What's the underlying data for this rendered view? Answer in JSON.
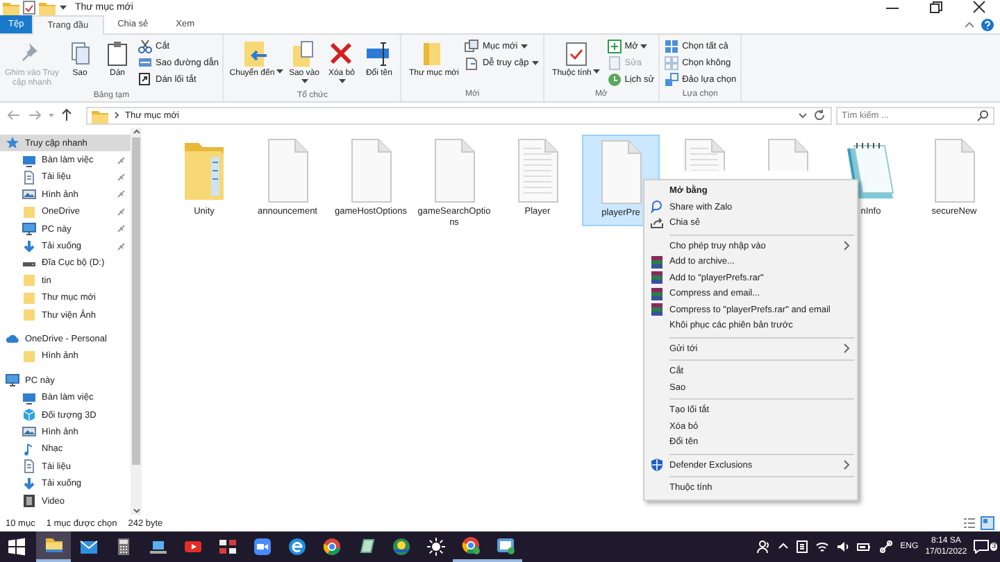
{
  "window": {
    "title": "Thư mục mới"
  },
  "ribbon_tabs": [
    {
      "label": "Tệp",
      "kind": "file",
      "selected": false
    },
    {
      "label": "Trang đầu",
      "kind": "tab",
      "selected": true
    },
    {
      "label": "Chia sẻ",
      "kind": "tab",
      "selected": false
    },
    {
      "label": "Xem",
      "kind": "tab",
      "selected": false
    }
  ],
  "ribbon": {
    "groups": [
      {
        "label": "Bảng tạm",
        "buttons": [
          {
            "label": "Ghim vào Truy cập nhanh",
            "kind": "large",
            "disabled": true,
            "dropdown": false
          },
          {
            "label": "Sao",
            "kind": "large",
            "disabled": false,
            "dropdown": false
          },
          {
            "label": "Dán",
            "kind": "large",
            "disabled": false,
            "dropdown": false
          },
          {
            "label": "Cắt",
            "kind": "small",
            "disabled": false,
            "dropdown": false
          },
          {
            "label": "Sao đường dẫn",
            "kind": "small",
            "disabled": false,
            "dropdown": false
          },
          {
            "label": "Dán lối tắt",
            "kind": "small",
            "disabled": false,
            "dropdown": false
          }
        ]
      },
      {
        "label": "Tổ chức",
        "buttons": [
          {
            "label": "Chuyển đến",
            "kind": "large",
            "disabled": false,
            "dropdown": true
          },
          {
            "label": "Sao vào",
            "kind": "large",
            "disabled": false,
            "dropdown": true
          },
          {
            "label": "Xóa bỏ",
            "kind": "large",
            "disabled": false,
            "dropdown": true
          },
          {
            "label": "Đổi tên",
            "kind": "large",
            "disabled": false,
            "dropdown": false
          }
        ]
      },
      {
        "label": "Mới",
        "buttons": [
          {
            "label": "Thư mục mới",
            "kind": "large",
            "disabled": false,
            "dropdown": false
          },
          {
            "label": "Mục mới",
            "kind": "small",
            "disabled": false,
            "dropdown": true
          },
          {
            "label": "Dễ truy cập",
            "kind": "small",
            "disabled": false,
            "dropdown": true
          }
        ]
      },
      {
        "label": "Mở",
        "buttons": [
          {
            "label": "Thuộc tính",
            "kind": "large",
            "disabled": false,
            "dropdown": true
          },
          {
            "label": "Mở",
            "kind": "small",
            "disabled": false,
            "dropdown": true
          },
          {
            "label": "Sửa",
            "kind": "small",
            "disabled": true,
            "dropdown": false
          },
          {
            "label": "Lịch sử",
            "kind": "small",
            "disabled": false,
            "dropdown": false
          }
        ]
      },
      {
        "label": "Lựa chọn",
        "buttons": [
          {
            "label": "Chọn tất cả",
            "kind": "small",
            "disabled": false,
            "dropdown": false
          },
          {
            "label": "Chọn không",
            "kind": "small",
            "disabled": false,
            "dropdown": false
          },
          {
            "label": "Đảo lựa chọn",
            "kind": "small",
            "disabled": false,
            "dropdown": false
          }
        ]
      }
    ]
  },
  "address_bar": {
    "path": "Thư mục mới",
    "search": {
      "placeholder": "Tìm kiếm ..."
    }
  },
  "sidebar": {
    "items": [
      {
        "label": "Truy cập nhanh",
        "kind": "star",
        "selected": true,
        "children": [
          {
            "label": "Bàn làm việc",
            "kind": "desktop",
            "pinned": true,
            "selected": false
          },
          {
            "label": "Tài liệu",
            "kind": "document",
            "pinned": true,
            "selected": false
          },
          {
            "label": "Hình ảnh",
            "kind": "pictures",
            "pinned": true,
            "selected": false
          },
          {
            "label": "OneDrive",
            "kind": "folder",
            "pinned": true,
            "selected": false
          },
          {
            "label": "PC này",
            "kind": "pc",
            "pinned": true,
            "selected": false
          },
          {
            "label": "Tải xuống",
            "kind": "download",
            "pinned": true,
            "selected": false
          },
          {
            "label": "Đĩa Cục bộ (D:)",
            "kind": "drive",
            "pinned": false,
            "selected": false
          },
          {
            "label": "tin",
            "kind": "folder",
            "pinned": false,
            "selected": false
          },
          {
            "label": "Thư mục mới",
            "kind": "folder",
            "pinned": false,
            "selected": false
          },
          {
            "label": "Thư viện Ảnh",
            "kind": "folder",
            "pinned": false,
            "selected": false
          }
        ]
      },
      {
        "label": "OneDrive - Personal",
        "kind": "cloud",
        "selected": false,
        "children": [
          {
            "label": "Hình ảnh",
            "kind": "folder",
            "pinned": false,
            "selected": false
          }
        ]
      },
      {
        "label": "PC này",
        "kind": "pc",
        "selected": false,
        "children": [
          {
            "label": "Bàn làm việc",
            "kind": "desktop",
            "pinned": false,
            "selected": false
          },
          {
            "label": "Đối tượng 3D",
            "kind": "cube",
            "pinned": false,
            "selected": false
          },
          {
            "label": "Hình ảnh",
            "kind": "pictures",
            "pinned": false,
            "selected": false
          },
          {
            "label": "Nhạc",
            "kind": "music",
            "pinned": false,
            "selected": false
          },
          {
            "label": "Tài liệu",
            "kind": "document",
            "pinned": false,
            "selected": false
          },
          {
            "label": "Tải xuống",
            "kind": "download",
            "pinned": false,
            "selected": false
          },
          {
            "label": "Video",
            "kind": "video",
            "pinned": false,
            "selected": false
          }
        ]
      }
    ]
  },
  "files": [
    {
      "name": "Unity",
      "kind": "folder",
      "selected": false
    },
    {
      "name": "announcement",
      "kind": "document",
      "selected": false
    },
    {
      "name": "gameHostOptions",
      "kind": "document",
      "selected": false
    },
    {
      "name": "gameSearchOptions",
      "kind": "document",
      "selected": false
    },
    {
      "name": "Player",
      "kind": "text",
      "selected": false
    },
    {
      "name": "playerPre",
      "kind": "document",
      "selected": true
    },
    {
      "kind": "text",
      "selected": false
    },
    {
      "kind": "document",
      "selected": false
    },
    {
      "name": "nInfo",
      "kind": "notepad",
      "selected": false
    },
    {
      "name": "secureNew",
      "kind": "document",
      "selected": false
    }
  ],
  "context_menu": {
    "items": [
      {
        "label": "Mở bằng",
        "kind": "default",
        "submenu": false
      },
      {
        "label": "Share with Zalo",
        "kind": "zalo",
        "submenu": false
      },
      {
        "label": "Chia sẻ",
        "kind": "share",
        "submenu": false
      },
      {
        "kind": "separator"
      },
      {
        "label": "Cho phép truy nhập vào",
        "kind": "plain",
        "submenu": true
      },
      {
        "label": "Add to archive...",
        "kind": "archive",
        "submenu": false
      },
      {
        "label": "Add to \"playerPrefs.rar\"",
        "kind": "archive",
        "submenu": false
      },
      {
        "label": "Compress and email...",
        "kind": "archive",
        "submenu": false
      },
      {
        "label": "Compress to \"playerPrefs.rar\" and email",
        "kind": "archive",
        "submenu": false
      },
      {
        "label": "Khôi phục các phiên bản trước",
        "kind": "plain",
        "submenu": false
      },
      {
        "kind": "separator"
      },
      {
        "label": "Gửi tới",
        "kind": "plain",
        "submenu": true
      },
      {
        "kind": "separator"
      },
      {
        "label": "Cắt",
        "kind": "plain",
        "submenu": false
      },
      {
        "label": "Sao",
        "kind": "plain",
        "submenu": false
      },
      {
        "kind": "separator"
      },
      {
        "label": "Tạo lối tắt",
        "kind": "plain",
        "submenu": false
      },
      {
        "label": "Xóa bỏ",
        "kind": "plain",
        "submenu": false
      },
      {
        "label": "Đổi tên",
        "kind": "plain",
        "submenu": false
      },
      {
        "kind": "separator"
      },
      {
        "label": "Defender Exclusions",
        "kind": "shield",
        "submenu": true
      },
      {
        "kind": "separator"
      },
      {
        "label": "Thuộc tính",
        "kind": "plain",
        "submenu": false
      }
    ]
  },
  "status_bar": {
    "count": "10 mục",
    "selection": "1 mục được chọn",
    "size": "242 byte"
  },
  "taskbar": {
    "apps": [
      {
        "active": true,
        "running": true
      },
      {
        "active": false,
        "running": false
      },
      {
        "active": false,
        "running": false
      },
      {
        "active": false,
        "running": false
      },
      {
        "active": false,
        "running": false
      },
      {
        "active": false,
        "running": false
      },
      {
        "active": false,
        "running": false
      },
      {
        "active": false,
        "running": false
      },
      {
        "active": false,
        "running": false
      },
      {
        "active": false,
        "running": false
      },
      {
        "active": false,
        "running": false
      },
      {
        "active": false,
        "running": false
      },
      {
        "active": false,
        "running": true
      },
      {
        "active": false,
        "running": true
      }
    ],
    "language": "ENG",
    "time": "8:14 SA",
    "date": "17/01/2022",
    "notifications": "3"
  }
}
